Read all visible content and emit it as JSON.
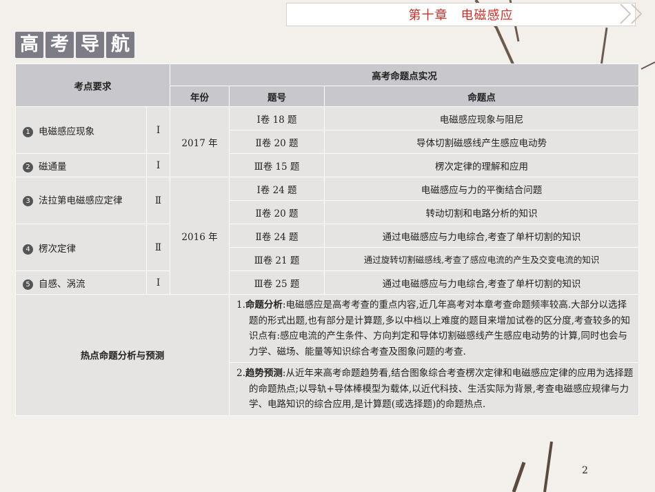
{
  "chapter_title": "第十章　电磁感应",
  "section_heading": [
    "高",
    "考",
    "导",
    "航"
  ],
  "table": {
    "col_requirement": "考点要求",
    "col_exam": "高考命题点实况",
    "col_year": "年份",
    "col_qno": "题号",
    "col_point": "命题点",
    "requirements": [
      {
        "num": "1",
        "name": "电磁感应现象",
        "level": "Ⅰ"
      },
      {
        "num": "2",
        "name": "磁通量",
        "level": "Ⅰ"
      },
      {
        "num": "3",
        "name": "法拉第电磁感应定律",
        "level": "Ⅱ"
      },
      {
        "num": "4",
        "name": "楞次定律",
        "level": "Ⅱ"
      },
      {
        "num": "5",
        "name": "自感、涡流",
        "level": "Ⅰ"
      }
    ],
    "years": [
      "2017 年",
      "2016 年"
    ],
    "rows": [
      {
        "qno": "Ⅰ卷 18 题",
        "point": "电磁感应现象与阻尼"
      },
      {
        "qno": "Ⅱ卷 20 题",
        "point": "导体切割磁感线产生感应电动势"
      },
      {
        "qno": "Ⅲ卷 15 题",
        "point": "楞次定律的理解和应用"
      },
      {
        "qno": "Ⅰ卷 24 题",
        "point": "电磁感应与力的平衡结合问题"
      },
      {
        "qno": "Ⅱ卷 20 题",
        "point": "转动切割和电路分析的知识"
      },
      {
        "qno": "Ⅱ卷 24 题",
        "point": "通过电磁感应与力电综合,考查了单杆切割的知识"
      },
      {
        "qno": "Ⅲ卷 21 题",
        "point": "通过旋转切割磁感线,考查了感应电流的产生及交变电流的知识"
      },
      {
        "qno": "Ⅲ卷 25 题",
        "point": "通过电磁感应与力电综合,考查了单杆切割的知识"
      }
    ],
    "hot_label": "热点命题分析与预测",
    "analysis": {
      "prefix": "1.",
      "title": "命题分析",
      "text": ":电磁感应是高考考查的重点内容,近几年高考对本章考查命题频率较高.大部分以选择题的形式出题,也有部分是计算题,多以中档以上难度的题目来增加试卷的区分度,考查较多的知识点有:感应电流的产生条件、方向判定和导体切割磁感线产生感应电动势的计算,同时也会与力学、磁场、能量等知识综合考查及图象问题的考查."
    },
    "forecast": {
      "prefix": "2.",
      "title": "趋势预测",
      "text": ":从近年来高考命题趋势看,结合图象综合考查楞次定律和电磁感应定律的应用为选择题的命题热点;以导轨+导体棒模型为载体,以近代科技、生活实际为背景,考查电磁感应规律与力学、电路知识的综合应用,是计算题(或选择题)的命题热点."
    }
  },
  "page_number": "2"
}
